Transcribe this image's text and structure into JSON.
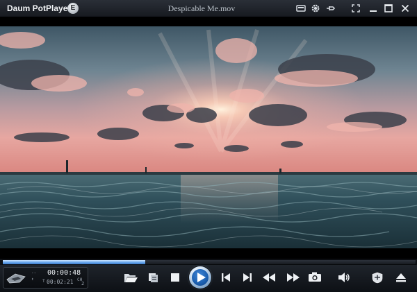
{
  "titlebar": {
    "app_name": "Daum PotPlayer",
    "edition_badge": "E",
    "file_title": "Despicable Me.mov",
    "icons": [
      "skin-icon",
      "settings-gear-icon",
      "pin-icon",
      "fullscreen-icon",
      "minimize-icon",
      "maximize-icon",
      "close-icon"
    ]
  },
  "seekbar": {
    "progress": 0.345
  },
  "info_panel": {
    "time_current": "00:00:48",
    "time_total": "00:02:21",
    "total_prefix": "T",
    "channel_label": "CH",
    "channel_value": "2"
  },
  "controls": {
    "icons": [
      "open-folder-icon",
      "playlist-icon",
      "stop-icon",
      "play-icon",
      "previous-icon",
      "next-icon",
      "rewind-icon",
      "fast-forward-icon",
      "screenshot-camera-icon",
      "volume-icon",
      "equalizer-badge-icon",
      "eject-icon"
    ]
  },
  "colors": {
    "accent": "#2c6fc4",
    "seek_fill": "#69a8ee",
    "title_text": "#f2f4f6"
  }
}
